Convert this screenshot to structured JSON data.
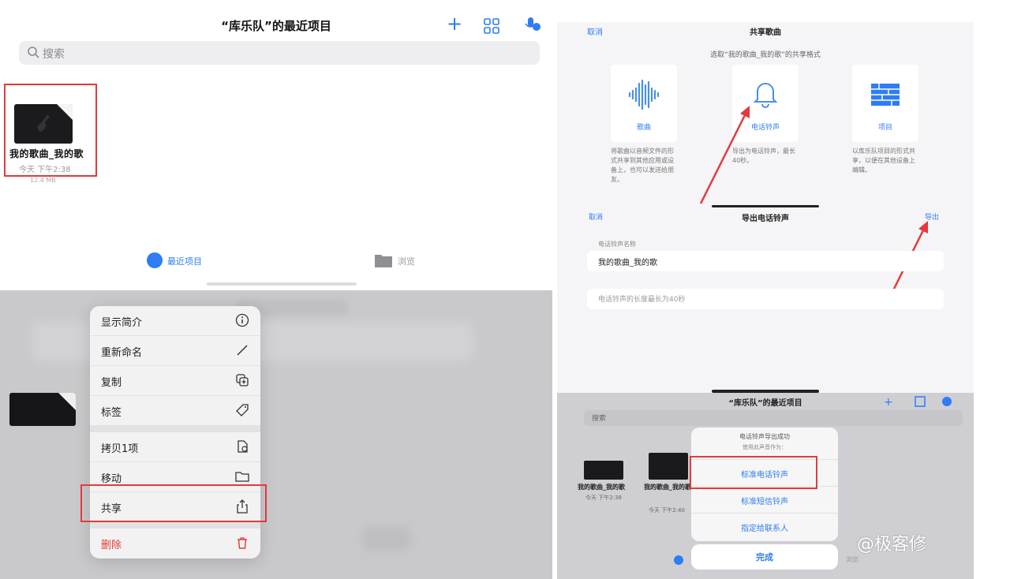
{
  "top_left": {
    "title": "“库乐队”的最近项目",
    "search_placeholder": "搜索",
    "file": {
      "name": "我的歌曲_我的歌",
      "date": "今天 下午2:38",
      "size": "12.4 MB"
    },
    "tabs": [
      {
        "label": "最近项目"
      },
      {
        "label": "浏览"
      }
    ]
  },
  "context_menu": {
    "items": [
      {
        "label": "显示简介",
        "icon": "info-icon"
      },
      {
        "label": "重新命名",
        "icon": "pencil-icon"
      },
      {
        "label": "复制",
        "icon": "duplicate-icon"
      },
      {
        "label": "标签",
        "icon": "tag-icon"
      },
      {
        "label": "拷贝1项",
        "icon": "copy-icon"
      },
      {
        "label": "移动",
        "icon": "folder-icon"
      },
      {
        "label": "共享",
        "icon": "share-icon"
      },
      {
        "label": "删除",
        "icon": "trash-icon"
      }
    ]
  },
  "share_sheet": {
    "cancel": "取消",
    "title": "共享歌曲",
    "subtitle": "选取“我的歌曲_我的歌”的共享格式",
    "options": [
      {
        "label": "歌曲",
        "desc": "将歌曲以音频文件的形式共享到其他应用或设备上，也可以发送给朋友。"
      },
      {
        "label": "电话铃声",
        "desc": "导出为电话铃声，最长40秒。"
      },
      {
        "label": "项目",
        "desc": "以库乐队项目的形式共享，以便在其他设备上编辑。"
      }
    ]
  },
  "ringtone_export": {
    "cancel": "取消",
    "title": "导出电话铃声",
    "export": "导出",
    "section_label": "电话铃声名称",
    "name_value": "我的歌曲_我的歌",
    "hint": "电话铃声的长度最长为40秒"
  },
  "bottom_right": {
    "title": "“库乐队”的最近项目",
    "search_placeholder": "搜索",
    "files": [
      {
        "name": "我的歌曲_我的歌",
        "date": "今天 下午2:38"
      },
      {
        "name": "我的歌曲_我的歌",
        "date": "今天 下午2:40"
      }
    ],
    "popup_title": "电话铃声导出成功",
    "popup_sub": "使用此声音作为：",
    "popup_options": [
      "标准电话铃声",
      "标准短信铃声",
      "指定给联系人"
    ],
    "done": "完成",
    "bottom_folder": "浏览"
  },
  "watermark": "@极客修",
  "colors": {
    "accent": "#2e7cf6",
    "highlight": "#e5393b"
  }
}
